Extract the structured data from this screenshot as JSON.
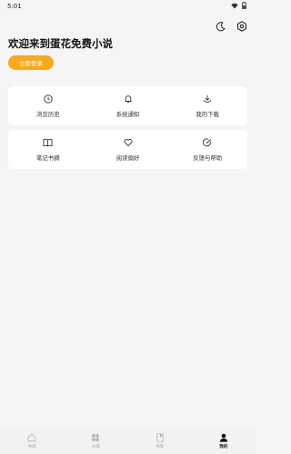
{
  "status_bar": {
    "time": "5:01"
  },
  "header": {
    "welcome_text": "欢迎来到蛋花免费小说",
    "login_button": "立即登录"
  },
  "grid_row1": [
    {
      "label": "浏览历史",
      "icon": "clock-icon"
    },
    {
      "label": "系统通知",
      "icon": "bell-icon"
    },
    {
      "label": "我的下载",
      "icon": "download-icon"
    }
  ],
  "grid_row2": [
    {
      "label": "笔记书摘",
      "icon": "book-open-icon"
    },
    {
      "label": "阅读偏好",
      "icon": "heart-icon"
    },
    {
      "label": "反馈与帮助",
      "icon": "edit-icon"
    }
  ],
  "bottom_nav": [
    {
      "label": "书城",
      "icon": "home-icon",
      "active": false
    },
    {
      "label": "分类",
      "icon": "category-icon",
      "active": false
    },
    {
      "label": "书架",
      "icon": "bookshelf-icon",
      "active": false
    },
    {
      "label": "我的",
      "icon": "profile-icon",
      "active": true
    }
  ],
  "colors": {
    "accent": "#f6a922",
    "background": "#f5f5f5",
    "card": "#ffffff"
  }
}
